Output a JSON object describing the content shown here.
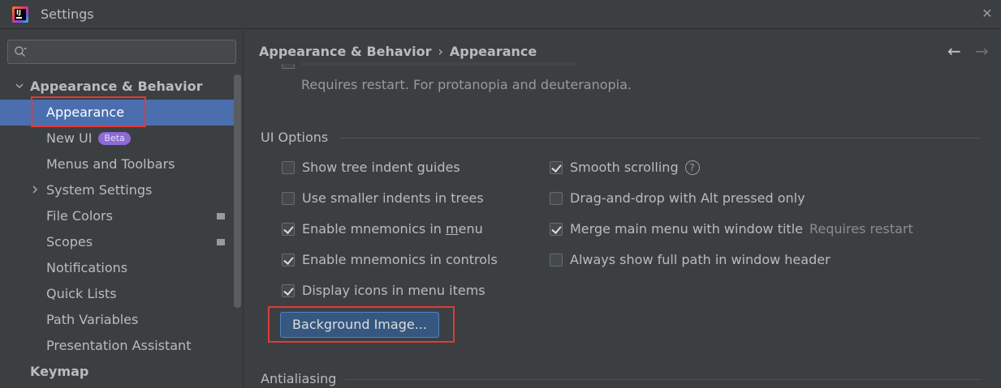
{
  "window": {
    "title": "Settings",
    "close_glyph": "✕"
  },
  "search": {
    "value": "",
    "placeholder": ""
  },
  "sidebar": {
    "items": [
      {
        "label": "Appearance & Behavior",
        "level": 0,
        "expanded": true
      },
      {
        "label": "Appearance",
        "level": 1,
        "selected": true
      },
      {
        "label": "New UI",
        "level": 1,
        "badge": "Beta"
      },
      {
        "label": "Menus and Toolbars",
        "level": 1
      },
      {
        "label": "System Settings",
        "level": 1,
        "collapsed": true
      },
      {
        "label": "File Colors",
        "level": 1
      },
      {
        "label": "Scopes",
        "level": 1
      },
      {
        "label": "Notifications",
        "level": 1
      },
      {
        "label": "Quick Lists",
        "level": 1
      },
      {
        "label": "Path Variables",
        "level": 1
      },
      {
        "label": "Presentation Assistant",
        "level": 1
      },
      {
        "label": "Keymap",
        "level": 0
      }
    ]
  },
  "breadcrumb": {
    "parent": "Appearance & Behavior",
    "separator": "›",
    "current": "Appearance"
  },
  "nav": {
    "back_glyph": "←",
    "forward_glyph": "→"
  },
  "main": {
    "restart_note": "Requires restart. For protanopia and deuteranopia.",
    "ui_options": {
      "title": "UI Options",
      "left": [
        {
          "label": "Show tree indent guides",
          "checked": false
        },
        {
          "label": "Use smaller indents in trees",
          "checked": false
        },
        {
          "label_pre": "Enable mnemonics in ",
          "label_mnemonic": "m",
          "label_post": "enu",
          "checked": true
        },
        {
          "label": "Enable mnemonics in controls",
          "checked": true
        },
        {
          "label": "Display icons in menu items",
          "checked": true
        }
      ],
      "right": [
        {
          "label": "Smooth scrolling",
          "checked": true,
          "help": "?"
        },
        {
          "label": "Drag-and-drop with Alt pressed only",
          "checked": false
        },
        {
          "label": "Merge main menu with window title",
          "checked": true,
          "hint": "Requires restart"
        },
        {
          "label": "Always show full path in window header",
          "checked": false
        }
      ],
      "background_button": "Background Image..."
    },
    "antialiasing": {
      "title": "Antialiasing"
    }
  },
  "colors": {
    "background": "#3c3f41",
    "selection": "#4b6eaf",
    "badge": "#8e6ad8",
    "highlight_box": "#e03a3a",
    "button": "#365880"
  }
}
